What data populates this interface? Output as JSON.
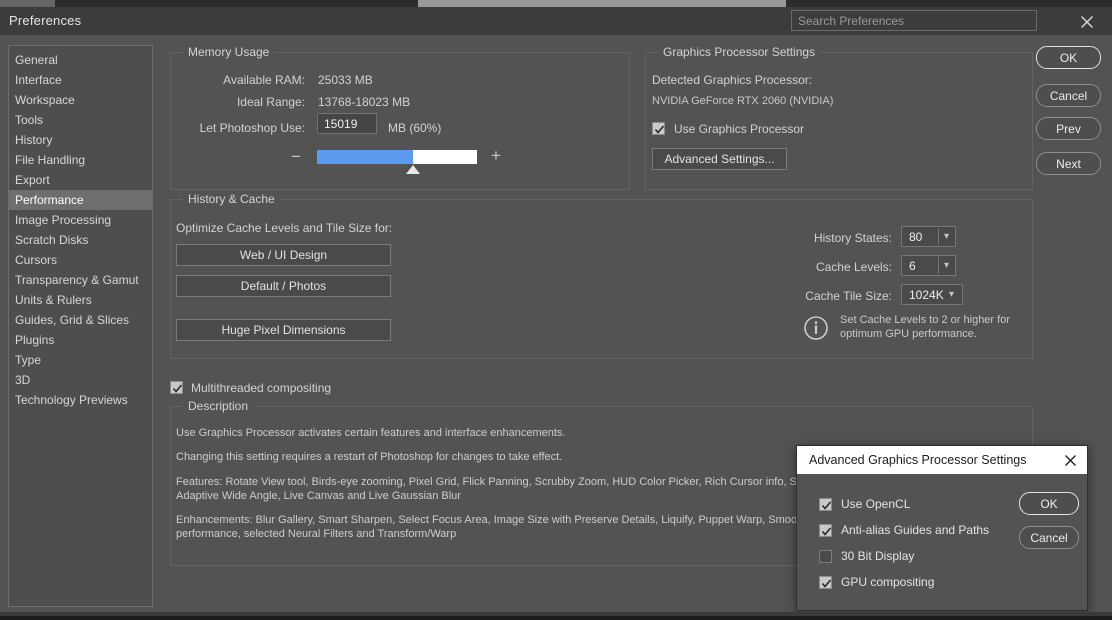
{
  "window": {
    "title": "Preferences",
    "search_placeholder": "Search Preferences",
    "close_icon": "close-icon"
  },
  "sidebar": {
    "items": [
      {
        "label": "General",
        "selected": false
      },
      {
        "label": "Interface",
        "selected": false
      },
      {
        "label": "Workspace",
        "selected": false
      },
      {
        "label": "Tools",
        "selected": false
      },
      {
        "label": "History",
        "selected": false
      },
      {
        "label": "File Handling",
        "selected": false
      },
      {
        "label": "Export",
        "selected": false
      },
      {
        "label": "Performance",
        "selected": true
      },
      {
        "label": "Image Processing",
        "selected": false
      },
      {
        "label": "Scratch Disks",
        "selected": false
      },
      {
        "label": "Cursors",
        "selected": false
      },
      {
        "label": "Transparency & Gamut",
        "selected": false
      },
      {
        "label": "Units & Rulers",
        "selected": false
      },
      {
        "label": "Guides, Grid & Slices",
        "selected": false
      },
      {
        "label": "Plugins",
        "selected": false
      },
      {
        "label": "Type",
        "selected": false
      },
      {
        "label": "3D",
        "selected": false
      },
      {
        "label": "Technology Previews",
        "selected": false
      }
    ]
  },
  "memory_usage": {
    "group_title": "Memory Usage",
    "available_ram_label": "Available RAM:",
    "available_ram_value": "25033 MB",
    "ideal_range_label": "Ideal Range:",
    "ideal_range_value": "13768-18023 MB",
    "let_photoshop_use_label": "Let Photoshop Use:",
    "let_photoshop_use_value": "15019",
    "unit_percent": "MB (60%)",
    "slider_percent": 60,
    "slider_minus": "−",
    "slider_plus": "+",
    "slider_fill_color": "#5b9bf0"
  },
  "graphics_processor": {
    "group_title": "Graphics Processor Settings",
    "detected_label": "Detected Graphics Processor:",
    "detected_value": "NVIDIA GeForce RTX 2060 (NVIDIA)",
    "use_gpu_label": "Use Graphics Processor",
    "use_gpu_checked": true,
    "advanced_button": "Advanced Settings..."
  },
  "history_cache": {
    "group_title": "History & Cache",
    "optimize_label": "Optimize Cache Levels and Tile Size for:",
    "preset_buttons": [
      "Web / UI Design",
      "Default / Photos",
      "Huge Pixel Dimensions"
    ],
    "history_states_label": "History States:",
    "history_states_value": "80",
    "cache_levels_label": "Cache Levels:",
    "cache_levels_value": "6",
    "cache_tile_size_label": "Cache Tile Size:",
    "cache_tile_size_value": "1024K",
    "info_icon": "info-icon",
    "info_note": "Set Cache Levels to 2 or higher for optimum GPU performance."
  },
  "multithreaded": {
    "label": "Multithreaded compositing",
    "checked": true
  },
  "description": {
    "group_title": "Description",
    "paragraphs": [
      "Use Graphics Processor activates certain features and interface enhancements.",
      "Changing this setting requires a restart of Photoshop for changes to take effect.",
      "Features: Rotate View tool, Birds-eye zooming, Pixel Grid, Flick Panning, Scrubby Zoom, HUD Color Picker, Rich Cursor info, Sampling Ring",
      "Adaptive Wide Angle, Live Canvas and Live Gaussian Blur",
      "Enhancements: Blur Gallery, Smart Sharpen, Select Focus Area, Image Size with Preserve Details, Liquify, Puppet Warp, Smooth Pan and",
      "performance, selected Neural Filters and Transform/Warp"
    ]
  },
  "action_buttons": [
    {
      "label": "OK",
      "primary": true
    },
    {
      "label": "Cancel",
      "primary": false
    },
    {
      "label": "Prev",
      "primary": false
    },
    {
      "label": "Next",
      "primary": false
    }
  ],
  "advanced_modal": {
    "title": "Advanced Graphics Processor Settings",
    "close_icon": "close-icon",
    "options": [
      {
        "label": "Use OpenCL",
        "checked": true
      },
      {
        "label": "Anti-alias Guides and Paths",
        "checked": true
      },
      {
        "label": "30 Bit Display",
        "checked": false
      },
      {
        "label": "GPU compositing",
        "checked": true
      }
    ],
    "ok_label": "OK",
    "cancel_label": "Cancel"
  }
}
